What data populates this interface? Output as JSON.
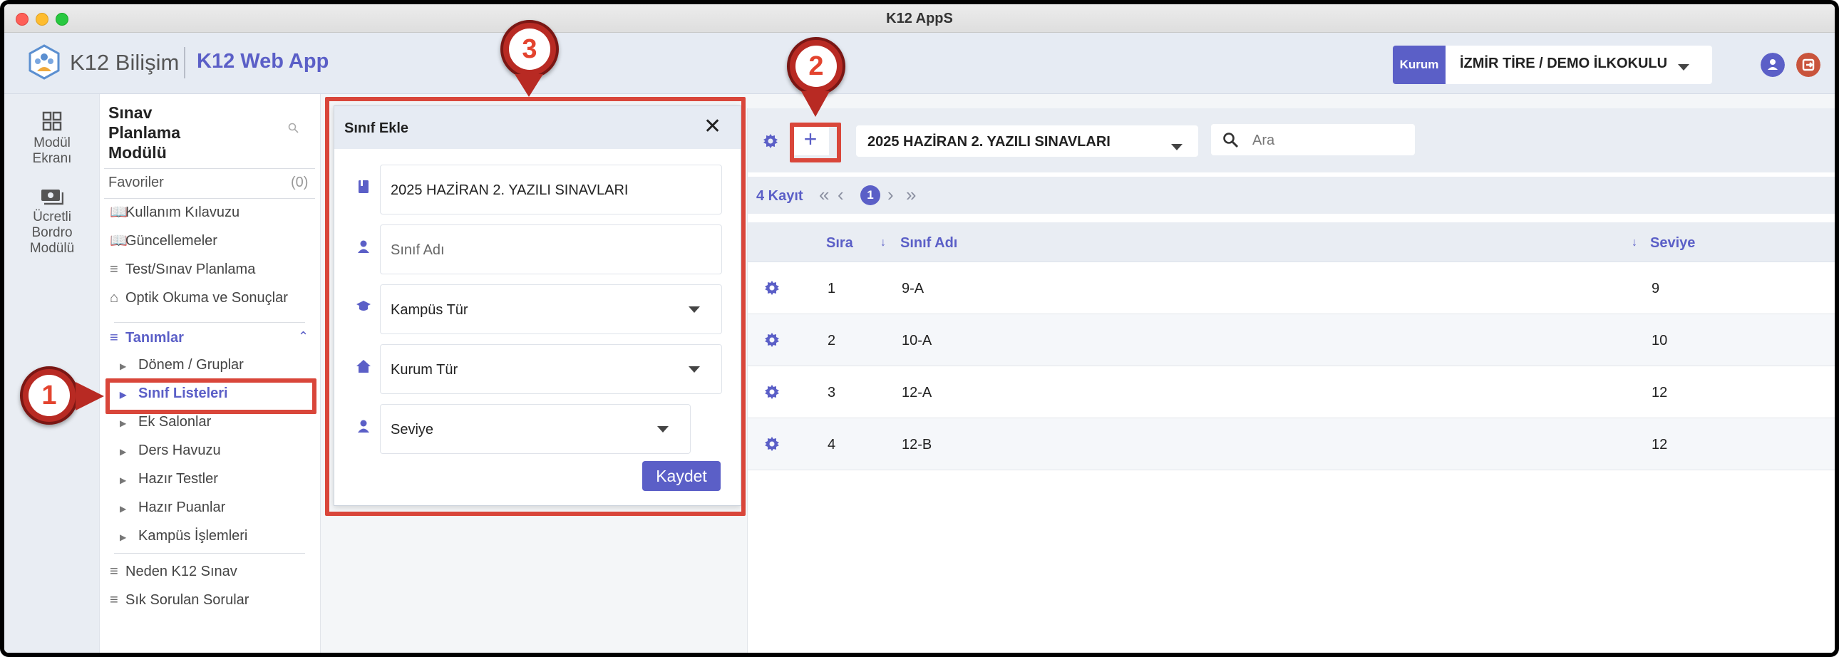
{
  "window": {
    "title": "K12 AppS"
  },
  "header": {
    "brand": "K12 Bilişim",
    "app_name": "K12 Web App",
    "kurum_label": "Kurum",
    "kurum_value": "İZMİR TİRE / DEMO İLKOKULU"
  },
  "rail": {
    "items": [
      {
        "label_line1": "Modül",
        "label_line2": "Ekranı"
      },
      {
        "label_line1": "Ücretli",
        "label_line2": "Bordro",
        "label_line3": "Modülü"
      }
    ]
  },
  "menu": {
    "title_line1": "Sınav",
    "title_line2": "Planlama",
    "title_line3": "Modülü",
    "favorites_label": "Favoriler",
    "favorites_count": "(0)",
    "items": [
      "Kullanım Kılavuzu",
      "Güncellemeler",
      "Test/Sınav Planlama",
      "Optik Okuma ve Sonuçlar"
    ],
    "section": "Tanımlar",
    "subitems": [
      "Dönem / Gruplar",
      "Sınıf Listeleri",
      "Ek Salonlar",
      "Ders Havuzu",
      "Hazır Testler",
      "Hazır Puanlar",
      "Kampüs İşlemleri"
    ],
    "footer_items": [
      "Neden K12 Sınav",
      "Sık Sorulan Sorular"
    ]
  },
  "callouts": [
    "1",
    "2",
    "3"
  ],
  "modal": {
    "title": "Sınıf Ekle",
    "close_glyph": "✕",
    "exam_value": "2025 HAZİRAN 2. YAZILI SINAVLARI",
    "class_name_placeholder": "Sınıf Adı",
    "campus_type_placeholder": "Kampüs Tür",
    "institution_type_placeholder": "Kurum Tür",
    "level_placeholder": "Seviye",
    "save_label": "Kaydet"
  },
  "toolbar": {
    "add_glyph": "+",
    "exam_select": "2025 HAZİRAN 2. YAZILI SINAVLARI",
    "search_placeholder": "Ara"
  },
  "pager": {
    "record_count": "4 Kayıt",
    "first": "«",
    "prev": "‹",
    "current_page": "1",
    "next": "›",
    "last": "»"
  },
  "table": {
    "headers": {
      "order": "Sıra",
      "name": "Sınıf Adı",
      "level": "Seviye"
    },
    "rows": [
      {
        "order": "1",
        "name": "9-A",
        "level": "9"
      },
      {
        "order": "2",
        "name": "10-A",
        "level": "10"
      },
      {
        "order": "3",
        "name": "12-A",
        "level": "12"
      },
      {
        "order": "4",
        "name": "12-B",
        "level": "12"
      }
    ]
  },
  "colors": {
    "accent": "#5b5fc7",
    "highlight": "#d9463a",
    "header_bg": "#e6ebf3"
  }
}
